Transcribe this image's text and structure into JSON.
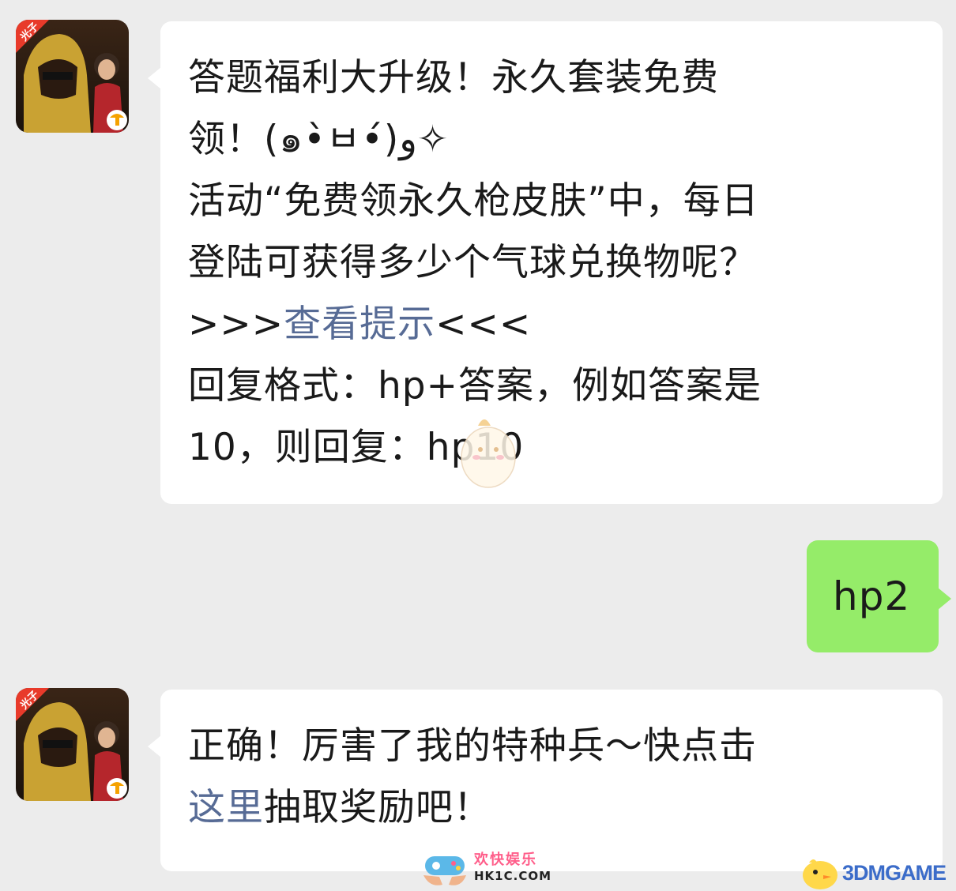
{
  "messages": [
    {
      "sender": "official-account",
      "avatar": {
        "badge_text": "光子",
        "logo": "tencent-games-logo"
      },
      "lines": [
        "答题福利大升级！永久套装免费",
        "领！(๑•̀ㅂ•́)و✧",
        "活动“免费领永久枪皮肤”中，每日",
        "登陆可获得多少个气球兑换物呢？"
      ],
      "hint_prefix": ">>>",
      "hint_link": "查看提示",
      "hint_suffix": "<<<",
      "reply_lines": [
        "回复格式：hp+答案，例如答案是",
        "10，则回复：hp10"
      ]
    },
    {
      "sender": "me",
      "text": "hp2"
    },
    {
      "sender": "official-account",
      "avatar": {
        "badge_text": "光子",
        "logo": "tencent-games-logo"
      },
      "line1": "正确！厉害了我的特种兵～快点击",
      "link": "这里",
      "line2_rest": "抽取奖励吧！"
    }
  ],
  "watermarks": {
    "center_cn": "欢快娱乐",
    "center_en": "HK1C.COM",
    "right": "3DMGAME"
  },
  "colors": {
    "background": "#ececec",
    "incoming_bubble": "#ffffff",
    "outgoing_bubble": "#95ec69",
    "link": "#576b95"
  }
}
